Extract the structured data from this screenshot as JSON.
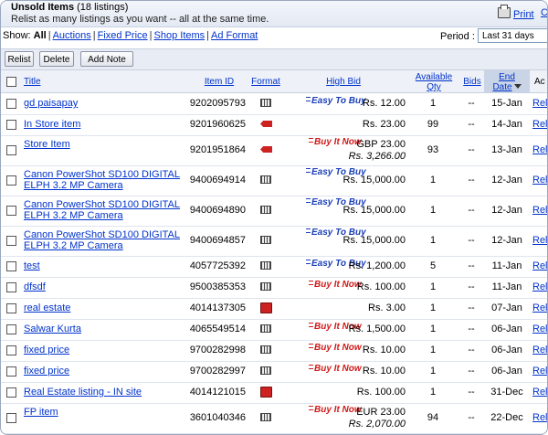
{
  "page": {
    "title": "Unsold Items",
    "count_label": "(18 listings)",
    "subtitle": "Relist as many listings as you want -- all at the same time.",
    "print_label": "Print",
    "print_icon": "printer-icon",
    "customize_label": "C"
  },
  "filter": {
    "show_label": "Show:",
    "all": "All",
    "auctions": "Auctions",
    "fixed_price": "Fixed Price",
    "shop_items": "Shop Items",
    "ad_format": "Ad Format",
    "period_label": "Period :",
    "period_value": "Last 31 days"
  },
  "toolbar": {
    "relist": "Relist",
    "delete": "Delete",
    "add_note": "Add Note"
  },
  "columns": {
    "title": "Title",
    "item_id": "Item ID",
    "format": "Format",
    "high_bid": "High Bid",
    "available_qty_1": "Available",
    "available_qty_2": "Qty",
    "bids": "Bids",
    "end_date_1": "End",
    "end_date_2": "Date",
    "action": "Ac"
  },
  "logos": {
    "easy": "Easy To Buy",
    "bin": "Buy It Now"
  },
  "colors": {
    "link": "#0033cc",
    "easy_logo": "#1a3fb8",
    "bin_logo": "#d11a1a",
    "sorted_header": "#c9d4e6"
  },
  "rows": [
    {
      "title1": "gd paisapay",
      "title2": "",
      "id": "9202095793",
      "format": "fixed-price-icon",
      "logo": "easy",
      "bid1": "Rs. 12.00",
      "bid2": "",
      "qty": "1",
      "bids": "--",
      "end": "15-Jan",
      "action": "Relis"
    },
    {
      "title1": "In Store item",
      "title2": "",
      "id": "9201960625",
      "format": "store-tag-icon",
      "logo": "",
      "bid1": "Rs. 23.00",
      "bid2": "",
      "qty": "99",
      "bids": "--",
      "end": "14-Jan",
      "action": "Relis"
    },
    {
      "title1": "Store Item",
      "title2": "",
      "id": "9201951864",
      "format": "store-tag-icon",
      "logo": "bin",
      "bid1": "GBP 23.00",
      "bid2": "Rs. 3,266.00",
      "qty": "93",
      "bids": "--",
      "end": "13-Jan",
      "action": "Relis"
    },
    {
      "title1": "Canon PowerShot SD100 DIGITAL",
      "title2": "ELPH 3.2 MP Camera",
      "id": "9400694914",
      "format": "fixed-price-icon",
      "logo": "easy",
      "bid1": "Rs. 15,000.00",
      "bid2": "",
      "qty": "1",
      "bids": "--",
      "end": "12-Jan",
      "action": "Relis"
    },
    {
      "title1": "Canon PowerShot SD100 DIGITAL",
      "title2": "ELPH 3.2 MP Camera",
      "id": "9400694890",
      "format": "fixed-price-icon",
      "logo": "easy",
      "bid1": "Rs. 15,000.00",
      "bid2": "",
      "qty": "1",
      "bids": "--",
      "end": "12-Jan",
      "action": "Relis"
    },
    {
      "title1": "Canon PowerShot SD100 DIGITAL",
      "title2": "ELPH 3.2 MP Camera",
      "id": "9400694857",
      "format": "fixed-price-icon",
      "logo": "easy",
      "bid1": "Rs. 15,000.00",
      "bid2": "",
      "qty": "1",
      "bids": "--",
      "end": "12-Jan",
      "action": "Relis"
    },
    {
      "title1": "test",
      "title2": "",
      "id": "4057725392",
      "format": "fixed-price-icon",
      "logo": "easy",
      "bid1": "Rs. 1,200.00",
      "bid2": "",
      "qty": "5",
      "bids": "--",
      "end": "11-Jan",
      "action": "Relis"
    },
    {
      "title1": "dfsdf",
      "title2": "",
      "id": "9500385353",
      "format": "fixed-price-icon",
      "logo": "bin",
      "bid1": "Rs. 100.00",
      "bid2": "",
      "qty": "1",
      "bids": "--",
      "end": "11-Jan",
      "action": "Relis"
    },
    {
      "title1": "real estate",
      "title2": "",
      "id": "4014137305",
      "format": "real-estate-icon",
      "logo": "",
      "bid1": "Rs. 3.00",
      "bid2": "",
      "qty": "1",
      "bids": "--",
      "end": "07-Jan",
      "action": "Relis"
    },
    {
      "title1": "Salwar Kurta",
      "title2": "",
      "id": "4065549514",
      "format": "fixed-price-icon",
      "logo": "bin",
      "bid1": "Rs. 1,500.00",
      "bid2": "",
      "qty": "1",
      "bids": "--",
      "end": "06-Jan",
      "action": "Relis"
    },
    {
      "title1": "fixed price",
      "title2": "",
      "id": "9700282998",
      "format": "fixed-price-icon",
      "logo": "bin",
      "bid1": "Rs. 10.00",
      "bid2": "",
      "qty": "1",
      "bids": "--",
      "end": "06-Jan",
      "action": "Relis"
    },
    {
      "title1": "fixed price",
      "title2": "",
      "id": "9700282997",
      "format": "fixed-price-icon",
      "logo": "bin",
      "bid1": "Rs. 10.00",
      "bid2": "",
      "qty": "1",
      "bids": "--",
      "end": "06-Jan",
      "action": "Relis"
    },
    {
      "title1": "Real Estate listing - IN site",
      "title2": "",
      "id": "4014121015",
      "format": "real-estate-icon",
      "logo": "",
      "bid1": "Rs. 100.00",
      "bid2": "",
      "qty": "1",
      "bids": "--",
      "end": "31-Dec",
      "action": "Relis"
    },
    {
      "title1": "FP item",
      "title2": "",
      "id": "3601040346",
      "format": "fixed-price-icon",
      "logo": "bin",
      "bid1": "EUR 23.00",
      "bid2": "Rs. 2,070.00",
      "qty": "94",
      "bids": "--",
      "end": "22-Dec",
      "action": "Relis"
    }
  ]
}
